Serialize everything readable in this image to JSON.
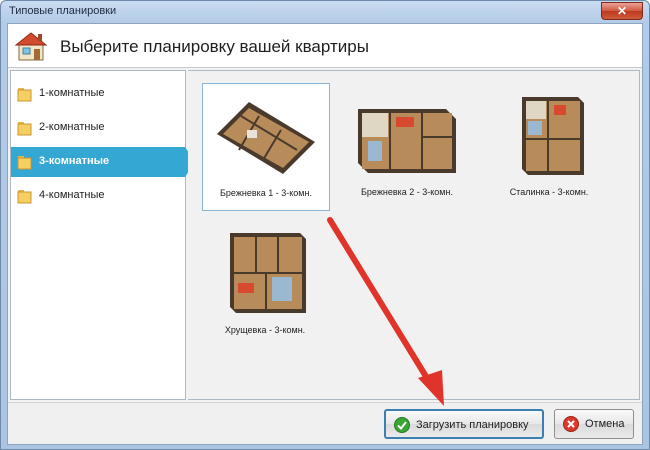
{
  "window": {
    "title": "Типовые планировки",
    "close_label": "✕"
  },
  "header": {
    "title": "Выберите планировку вашей квартиры",
    "icon": "house-icon"
  },
  "sidebar": {
    "items": [
      {
        "label": "1-комнатные",
        "active": false
      },
      {
        "label": "2-комнатные",
        "active": false
      },
      {
        "label": "3-комнатные",
        "active": true
      },
      {
        "label": "4-комнатные",
        "active": false
      }
    ]
  },
  "gallery": {
    "items": [
      {
        "label": "Брежневка 1 - 3-комн.",
        "selected": true
      },
      {
        "label": "Брежневка 2 - 3-комн.",
        "selected": false
      },
      {
        "label": "Сталинка - 3-комн.",
        "selected": false
      },
      {
        "label": "Хрущевка - 3-комн.",
        "selected": false
      }
    ]
  },
  "footer": {
    "load_label": "Загрузить планировку",
    "cancel_label": "Отмена"
  },
  "colors": {
    "accent": "#35a7d3",
    "arrow": "#e0342a",
    "ok": "#3aa534",
    "cancel": "#d93a2b"
  }
}
